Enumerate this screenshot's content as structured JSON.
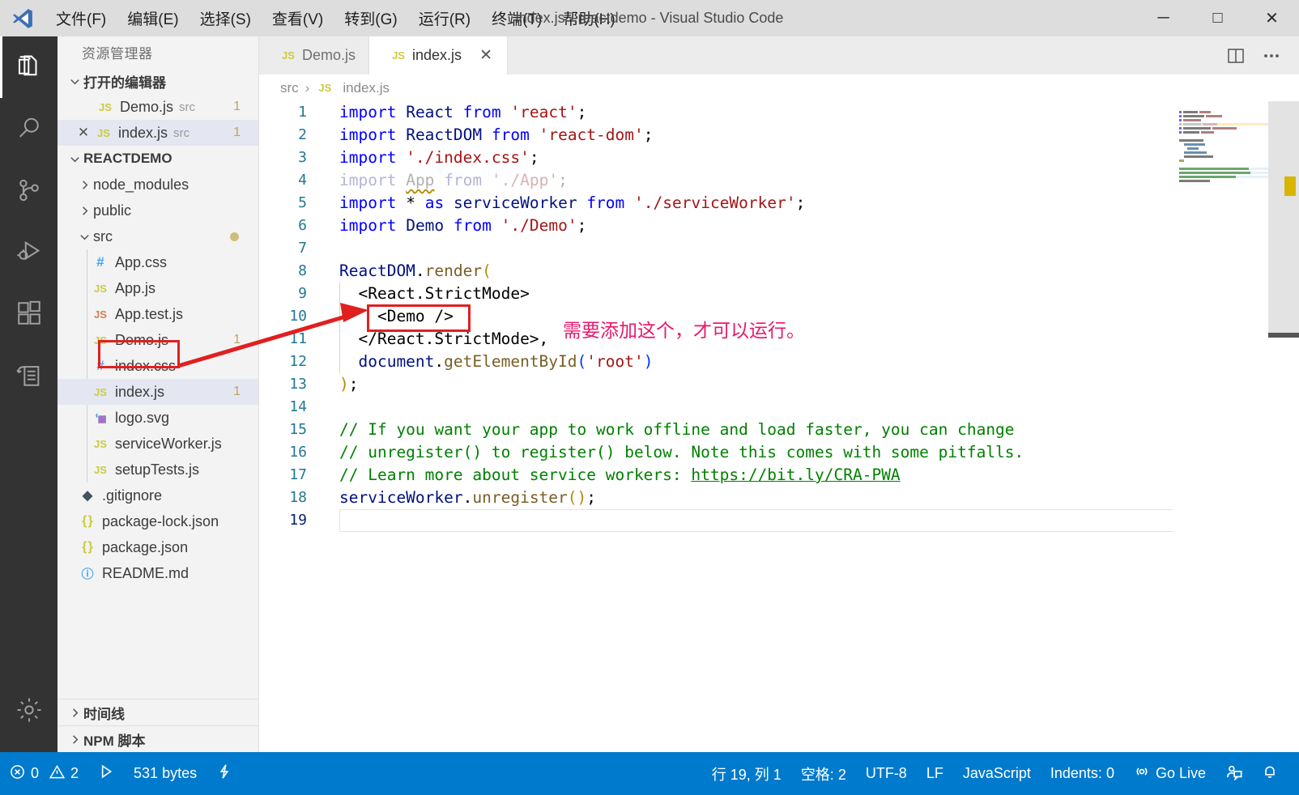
{
  "window": {
    "title": "index.js - reactdemo - Visual Studio Code",
    "minimize": "─",
    "maximize": "□",
    "close": "✕"
  },
  "menu": {
    "items": [
      {
        "label": "文件(F)",
        "name": "menu-file"
      },
      {
        "label": "编辑(E)",
        "name": "menu-edit"
      },
      {
        "label": "选择(S)",
        "name": "menu-selection"
      },
      {
        "label": "查看(V)",
        "name": "menu-view"
      },
      {
        "label": "转到(G)",
        "name": "menu-go"
      },
      {
        "label": "运行(R)",
        "name": "menu-run"
      },
      {
        "label": "终端(T)",
        "name": "menu-terminal"
      },
      {
        "label": "帮助(H)",
        "name": "menu-help"
      }
    ]
  },
  "activitybar": {
    "items": [
      {
        "name": "explorer-icon",
        "active": true
      },
      {
        "name": "search-icon",
        "active": false
      },
      {
        "name": "source-control-icon",
        "active": false
      },
      {
        "name": "run-and-debug-icon",
        "active": false
      },
      {
        "name": "extensions-icon",
        "active": false
      },
      {
        "name": "remote-explorer-icon",
        "active": false
      }
    ],
    "settings": {
      "name": "manage-settings-gear-icon"
    }
  },
  "sidebar": {
    "title": "资源管理器",
    "open_editors": {
      "label": "打开的编辑器",
      "items": [
        {
          "icon": "JS",
          "name": "Demo.js",
          "desc": "src",
          "badge": "1",
          "selected": false,
          "showClose": false
        },
        {
          "icon": "JS",
          "name": "index.js",
          "desc": "src",
          "badge": "1",
          "selected": true,
          "showClose": true
        }
      ]
    },
    "project": {
      "label": "REACTDEMO",
      "items": [
        {
          "icon": "chevron",
          "type": "folder",
          "name": "node_modules",
          "depth": 1,
          "expanded": false
        },
        {
          "icon": "chevron",
          "type": "folder",
          "name": "public",
          "depth": 1,
          "expanded": false
        },
        {
          "icon": "chevron",
          "type": "folder",
          "name": "src",
          "depth": 1,
          "expanded": true,
          "modified": true
        },
        {
          "icon": "css",
          "type": "file",
          "name": "App.css",
          "depth": 2,
          "glyph": "#"
        },
        {
          "icon": "js",
          "type": "file",
          "name": "App.js",
          "depth": 2,
          "glyph": "JS"
        },
        {
          "icon": "js",
          "type": "file",
          "name": "App.test.js",
          "depth": 2,
          "glyph": "JS"
        },
        {
          "icon": "js",
          "type": "file",
          "name": "Demo.js",
          "depth": 2,
          "glyph": "JS",
          "badge": "1",
          "highlighted": true
        },
        {
          "icon": "css",
          "type": "file",
          "name": "index.css",
          "depth": 2,
          "glyph": "#"
        },
        {
          "icon": "js",
          "type": "file",
          "name": "index.js",
          "depth": 2,
          "glyph": "JS",
          "badge": "1",
          "selected": true
        },
        {
          "icon": "svg",
          "type": "file",
          "name": "logo.svg",
          "depth": 2,
          "glyph": "◨"
        },
        {
          "icon": "js",
          "type": "file",
          "name": "serviceWorker.js",
          "depth": 2,
          "glyph": "JS"
        },
        {
          "icon": "js",
          "type": "file",
          "name": "setupTests.js",
          "depth": 2,
          "glyph": "JS"
        },
        {
          "icon": "git",
          "type": "file",
          "name": ".gitignore",
          "depth": 1,
          "glyph": "◆"
        },
        {
          "icon": "json",
          "type": "file",
          "name": "package-lock.json",
          "depth": 1,
          "glyph": "{ }"
        },
        {
          "icon": "json",
          "type": "file",
          "name": "package.json",
          "depth": 1,
          "glyph": "{ }"
        },
        {
          "icon": "md",
          "type": "file",
          "name": "README.md",
          "depth": 1,
          "glyph": "ⓘ"
        }
      ]
    },
    "bottom_sections": [
      {
        "label": "时间线",
        "name": "sidebar-section-timeline"
      },
      {
        "label": "NPM 脚本",
        "name": "sidebar-section-npm-scripts"
      }
    ]
  },
  "editor": {
    "tabs": [
      {
        "icon": "JS",
        "label": "Demo.js",
        "active": false,
        "closable": false
      },
      {
        "icon": "JS",
        "label": "index.js",
        "active": true,
        "closable": true,
        "close": "✕"
      }
    ],
    "actions": [
      {
        "name": "split-editor-icon"
      },
      {
        "name": "more-actions-icon",
        "label": "•••"
      }
    ],
    "breadcrumb": {
      "folder": "src",
      "separator": "›",
      "icon": "JS",
      "file": "index.js"
    },
    "code_lines": [
      {
        "n": 1,
        "text": "import React from 'react';"
      },
      {
        "n": 2,
        "text": "import ReactDOM from 'react-dom';"
      },
      {
        "n": 3,
        "text": "import './index.css';"
      },
      {
        "n": 4,
        "text": "import App from './App';"
      },
      {
        "n": 5,
        "text": "import * as serviceWorker from './serviceWorker';"
      },
      {
        "n": 6,
        "text": "import Demo from './Demo';"
      },
      {
        "n": 7,
        "text": ""
      },
      {
        "n": 8,
        "text": "ReactDOM.render("
      },
      {
        "n": 9,
        "text": "  <React.StrictMode>"
      },
      {
        "n": 10,
        "text": "    <Demo />"
      },
      {
        "n": 11,
        "text": "  </React.StrictMode>,"
      },
      {
        "n": 12,
        "text": "  document.getElementById('root')"
      },
      {
        "n": 13,
        "text": ");"
      },
      {
        "n": 14,
        "text": ""
      },
      {
        "n": 15,
        "text": "// If you want your app to work offline and load faster, you can change"
      },
      {
        "n": 16,
        "text": "// unregister() to register() below. Note this comes with some pitfalls."
      },
      {
        "n": 17,
        "text": "// Learn more about service workers: https://bit.ly/CRA-PWA"
      },
      {
        "n": 18,
        "text": "serviceWorker.unregister();"
      },
      {
        "n": 19,
        "text": ""
      }
    ]
  },
  "annotations": {
    "note_text": "需要添加这个，才可以运行。",
    "box_color": "#e02020",
    "text_color": "#e8186c"
  },
  "statusbar": {
    "errors": "0",
    "warnings": "2",
    "size": "531 bytes",
    "position": "行 19, 列 1",
    "spaces": "空格: 2",
    "encoding": "UTF-8",
    "eol": "LF",
    "language": "JavaScript",
    "indents": "Indents: 0",
    "golive": "Go Live",
    "icons": {
      "error": "error-icon",
      "warning": "warning-icon",
      "run": "run-icon",
      "lightning": "lightning-icon",
      "broadcast": "broadcast-icon",
      "feedback": "feedback-icon",
      "bell": "bell-icon"
    }
  }
}
